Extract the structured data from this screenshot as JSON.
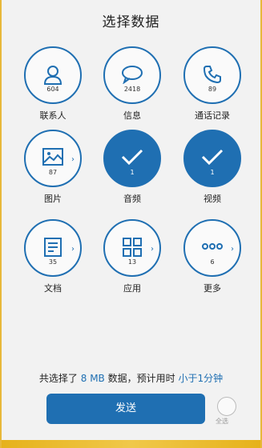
{
  "title": "选择数据",
  "items": [
    {
      "label": "联系人",
      "count": "604",
      "icon": "contact-person-icon",
      "selected": false
    },
    {
      "label": "信息",
      "count": "2418",
      "icon": "message-bubble-icon",
      "selected": false
    },
    {
      "label": "通话记录",
      "count": "89",
      "icon": "phone-icon",
      "selected": false
    },
    {
      "label": "图片",
      "count": "87",
      "icon": "image-icon",
      "selected": false
    },
    {
      "label": "音频",
      "count": "1",
      "icon": "checkmark-icon",
      "selected": true
    },
    {
      "label": "视频",
      "count": "1",
      "icon": "checkmark-icon",
      "selected": true
    },
    {
      "label": "文档",
      "count": "35",
      "icon": "document-icon",
      "selected": false
    },
    {
      "label": "应用",
      "count": "13",
      "icon": "apps-grid-icon",
      "selected": false
    },
    {
      "label": "更多",
      "count": "6",
      "icon": "more-dots-icon",
      "selected": false
    }
  ],
  "chevron": "›",
  "summary": {
    "prefix": "共选择了 ",
    "size": "8 MB",
    "middle": " 数据，预计用时 ",
    "time": "小于1分钟"
  },
  "send_label": "发送",
  "select_all_label": "全选",
  "colors": {
    "accent": "#1f6fb2"
  }
}
